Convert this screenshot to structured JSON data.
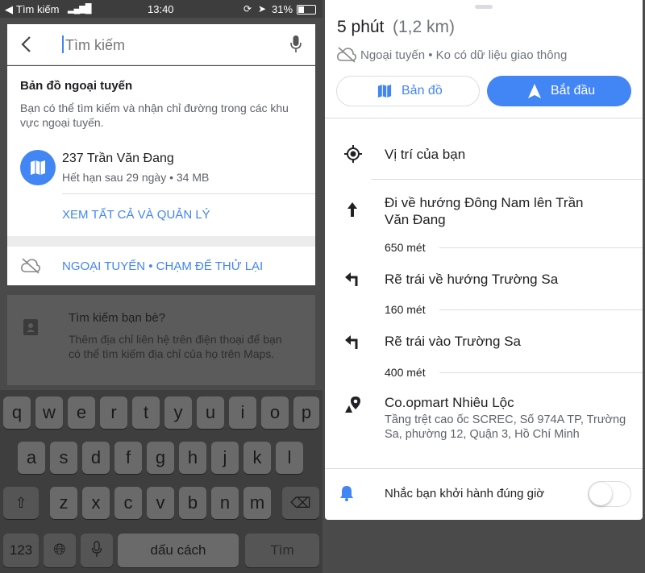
{
  "status": {
    "back_app": "Tìm kiếm",
    "time": "13:40",
    "battery": "31%"
  },
  "left": {
    "search": {
      "placeholder": "Tìm kiếm"
    },
    "offline_maps": {
      "title": "Bản đồ ngoại tuyến",
      "description": "Bạn có thể tìm kiếm và nhận chỉ đường trong các khu vực ngoại tuyến.",
      "item_name": "237 Trần Văn Đang",
      "item_meta": "Hết hạn sau 29 ngày • 34 MB",
      "manage_link": "XEM TẤT CẢ VÀ QUẢN LÝ"
    },
    "offline_bar": {
      "text": "NGOẠI TUYẾN • CHẠM ĐỂ THỬ LẠI"
    },
    "friends": {
      "title": "Tìm kiếm bạn bè?",
      "description": "Thêm địa chỉ liên hệ trên điện thoại để bạn có thể tìm kiếm địa chỉ của họ trên Maps."
    },
    "keyboard": {
      "row1": [
        "q",
        "w",
        "e",
        "r",
        "t",
        "y",
        "u",
        "i",
        "o",
        "p"
      ],
      "row2": [
        "a",
        "s",
        "d",
        "f",
        "g",
        "h",
        "j",
        "k",
        "l"
      ],
      "row3": [
        "z",
        "x",
        "c",
        "v",
        "b",
        "n",
        "m"
      ],
      "numbers": "123",
      "space": "dấu cách",
      "search_key": "Tìm"
    }
  },
  "right": {
    "duration": "5 phút",
    "distance": "(1,2 km)",
    "traffic": "Ngoại tuyến • Ko có dữ liệu giao thông",
    "map_button": "Bản đồ",
    "start_button": "Bắt đầu",
    "steps": [
      {
        "text": "Vị trí của bạn"
      },
      {
        "text": "Đi về hướng Đông Nam lên Trần Văn Đang",
        "distance": "650 mét"
      },
      {
        "text": "Rẽ trái về hướng Trường Sa",
        "distance": "160 mét"
      },
      {
        "text": "Rẽ trái vào Trường Sa",
        "distance": "400 mét"
      }
    ],
    "destination": {
      "name": "Co.opmart Nhiêu Lộc",
      "address": "Tầng trệt cao ốc SCREC, Số 974A TP, Trường Sa, phường 12, Quận 3, Hồ Chí Minh"
    },
    "reminder": {
      "label": "Nhắc bạn khởi hành đúng giờ",
      "enabled": false
    },
    "colors": {
      "accent": "#4285f4"
    }
  }
}
